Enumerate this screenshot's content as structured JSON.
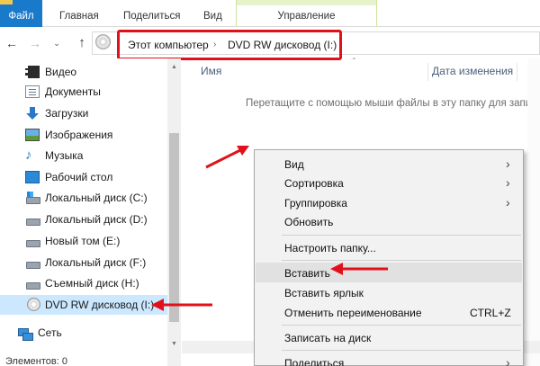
{
  "ribbon": {
    "tabs": [
      "Файл",
      "Главная",
      "Поделиться",
      "Вид",
      "Управление"
    ]
  },
  "address": {
    "crumbs": [
      "Этот компьютер",
      "DVD RW дисковод (I:)"
    ],
    "separator": "›"
  },
  "nav": {
    "back": "←",
    "forward": "→",
    "dropdown": "⌄",
    "up": "↑"
  },
  "sidebar": {
    "items": [
      {
        "label": "Видео",
        "icon": "video-icon"
      },
      {
        "label": "Документы",
        "icon": "documents-icon"
      },
      {
        "label": "Загрузки",
        "icon": "downloads-icon"
      },
      {
        "label": "Изображения",
        "icon": "pictures-icon"
      },
      {
        "label": "Музыка",
        "icon": "music-icon"
      },
      {
        "label": "Рабочий стол",
        "icon": "desktop-icon"
      },
      {
        "label": "Локальный диск (C:)",
        "icon": "windows-drive-icon"
      },
      {
        "label": "Локальный диск (D:)",
        "icon": "drive-icon"
      },
      {
        "label": "Новый том (E:)",
        "icon": "drive-icon"
      },
      {
        "label": "Локальный диск (F:)",
        "icon": "drive-icon"
      },
      {
        "label": "Съемный диск (H:)",
        "icon": "drive-icon"
      },
      {
        "label": "DVD RW дисковод (I:)",
        "icon": "dvd-icon"
      },
      {
        "label": "Сеть",
        "icon": "network-icon"
      }
    ]
  },
  "status": {
    "text": "Элементов: 0"
  },
  "columns": {
    "name": "Имя",
    "date": "Дата изменения"
  },
  "empty_message": "Перетащите с помощью мыши файлы в эту папку для запи",
  "context_menu": {
    "items": [
      {
        "label": "Вид",
        "submenu": true,
        "shortcut": ""
      },
      {
        "label": "Сортировка",
        "submenu": true,
        "shortcut": ""
      },
      {
        "label": "Группировка",
        "submenu": true,
        "shortcut": ""
      },
      {
        "label": "Обновить",
        "submenu": false,
        "shortcut": ""
      },
      {
        "label": "Настроить папку...",
        "submenu": false,
        "shortcut": ""
      },
      {
        "label": "Вставить",
        "submenu": false,
        "shortcut": ""
      },
      {
        "label": "Вставить ярлык",
        "submenu": false,
        "shortcut": ""
      },
      {
        "label": "Отменить переименование",
        "submenu": false,
        "shortcut": "CTRL+Z"
      },
      {
        "label": "Записать на диск",
        "submenu": false,
        "shortcut": ""
      },
      {
        "label": "Поделиться",
        "submenu": true,
        "shortcut": ""
      }
    ],
    "submenu_arrow": "›"
  },
  "colors": {
    "file_tab": "#1979ca",
    "selection": "#cce8ff",
    "highlight_red": "#e1101a",
    "menu_bg": "#f2f2f2"
  }
}
